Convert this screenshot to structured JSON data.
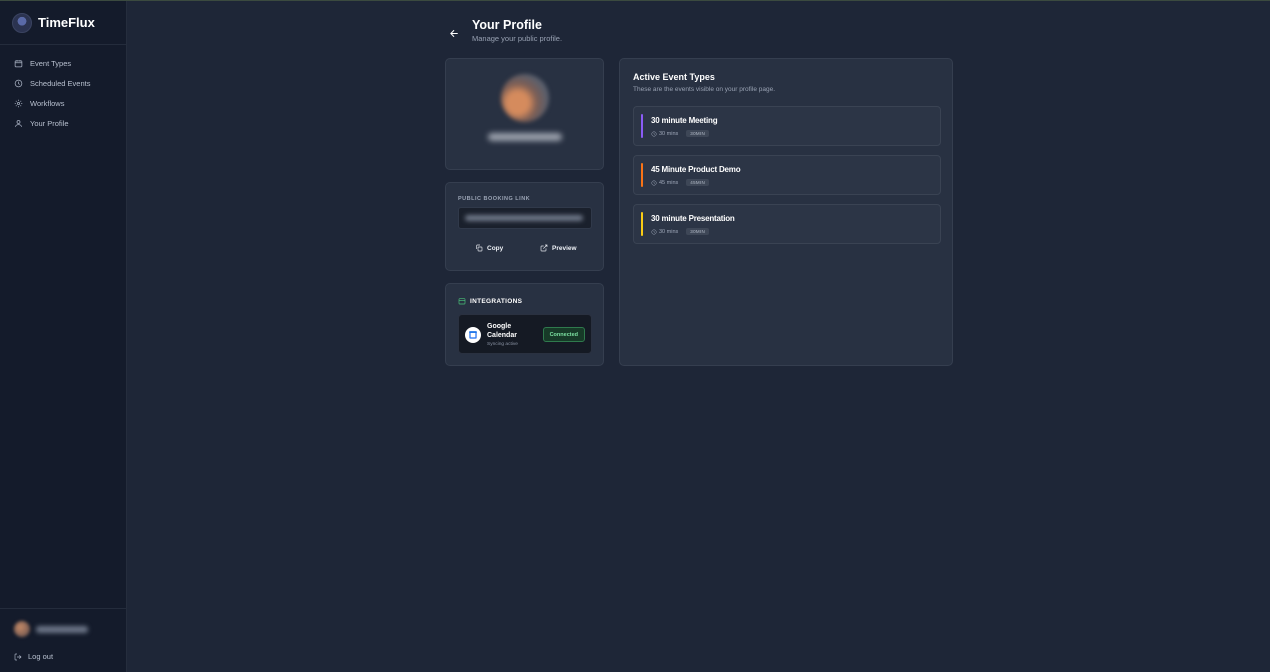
{
  "app": {
    "name": "TimeFlux"
  },
  "sidebar": {
    "items": [
      {
        "label": "Event Types",
        "icon": "calendar-icon"
      },
      {
        "label": "Scheduled Events",
        "icon": "clock-icon"
      },
      {
        "label": "Workflows",
        "icon": "gear-icon"
      },
      {
        "label": "Your Profile",
        "icon": "user-icon"
      }
    ],
    "logout_label": "Log out"
  },
  "header": {
    "title": "Your Profile",
    "subtitle": "Manage your public profile."
  },
  "booking": {
    "section_label": "PUBLIC BOOKING LINK",
    "copy_label": "Copy",
    "preview_label": "Preview"
  },
  "integrations": {
    "title": "INTEGRATIONS",
    "items": [
      {
        "name": "Google Calendar",
        "status_text": "Syncing active",
        "badge": "Connected",
        "badge_color": "#7de2a2"
      }
    ]
  },
  "events": {
    "title": "Active Event Types",
    "subtitle": "These are the events visible on your profile page.",
    "items": [
      {
        "name": "30 minute Meeting",
        "duration": "30 mins",
        "tag": "30MIN",
        "color": "#8b5cf6"
      },
      {
        "name": "45 Minute Product Demo",
        "duration": "45 mins",
        "tag": "45MIN",
        "color": "#f97316"
      },
      {
        "name": "30 minute Presentation",
        "duration": "30 mins",
        "tag": "30MIN",
        "color": "#facc15"
      }
    ]
  }
}
